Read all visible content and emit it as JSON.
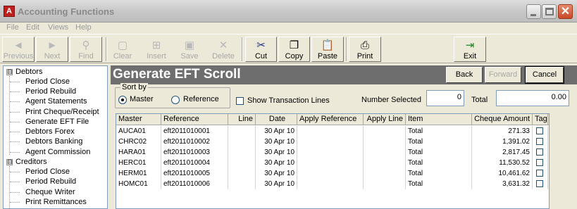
{
  "window": {
    "title": "Accounting Functions",
    "app_icon": "A",
    "close_glyph": "✕"
  },
  "menu": [
    "File",
    "Edit",
    "Views",
    "Help"
  ],
  "toolbar": {
    "previous": {
      "label": "Previous",
      "icon": "◄"
    },
    "next": {
      "label": "Next",
      "icon": "►"
    },
    "find": {
      "label": "Find",
      "icon": "⚲"
    },
    "clear": {
      "label": "Clear",
      "icon": "▢"
    },
    "insert": {
      "label": "Insert",
      "icon": "⊞"
    },
    "save": {
      "label": "Save",
      "icon": "▣"
    },
    "delete": {
      "label": "Delete",
      "icon": "✕"
    },
    "cut": {
      "label": "Cut",
      "icon": "✂"
    },
    "copy": {
      "label": "Copy",
      "icon": "❐"
    },
    "paste": {
      "label": "Paste",
      "icon": "📋"
    },
    "print": {
      "label": "Print",
      "icon": "⎙"
    },
    "exit": {
      "label": "Exit",
      "icon": "⇥"
    }
  },
  "tree": {
    "groups": [
      {
        "label": "Debtors",
        "expander": "⊟",
        "items": [
          "Period Close",
          "Period Rebuild",
          "Agent Statements",
          "Print Cheque/Receipt",
          "Generate EFT File",
          "Debtors Forex",
          "Debtors Banking",
          "Agent Commission"
        ]
      },
      {
        "label": "Creditors",
        "expander": "⊟",
        "items": [
          "Period Close",
          "Period Rebuild",
          "Cheque Writer",
          "Print Remittances"
        ]
      }
    ],
    "selected_item": "Generate EFT File"
  },
  "main": {
    "title": "Generate EFT Scroll",
    "back_label": "Back",
    "forward_label": "Forward",
    "cancel_label": "Cancel",
    "sort_by": {
      "legend": "Sort by",
      "options": [
        "Master",
        "Reference"
      ],
      "selected": "Master"
    },
    "show_transaction_lines_label": "Show Transaction Lines",
    "number_selected_label": "Number Selected",
    "number_selected_value": "0",
    "total_label": "Total",
    "total_value": "0.00"
  },
  "grid": {
    "columns": [
      "Master",
      "Reference",
      "Line",
      "Date",
      "Apply Reference",
      "Apply Line",
      "Item",
      "Cheque Amount",
      "Tag"
    ],
    "rows": [
      [
        "AUCA01",
        "eft2011010001",
        "",
        "30 Apr 10",
        "",
        "",
        "Total",
        "271.33",
        ""
      ],
      [
        "CHRC02",
        "eft2011010002",
        "",
        "30 Apr 10",
        "",
        "",
        "Total",
        "1,391.02",
        ""
      ],
      [
        "HARA01",
        "eft2011010003",
        "",
        "30 Apr 10",
        "",
        "",
        "Total",
        "2,817.45",
        ""
      ],
      [
        "HERC01",
        "eft2011010004",
        "",
        "30 Apr 10",
        "",
        "",
        "Total",
        "11,530.52",
        ""
      ],
      [
        "HERM01",
        "eft2011010005",
        "",
        "30 Apr 10",
        "",
        "",
        "Total",
        "10,461.62",
        ""
      ],
      [
        "HOMC01",
        "eft2011010006",
        "",
        "30 Apr 10",
        "",
        "",
        "Total",
        "3,631.32",
        ""
      ]
    ]
  },
  "colors": {
    "header_bar": "#6e6e6e",
    "window_face": "#ece9d8",
    "tree_border": "#7f9db9"
  }
}
